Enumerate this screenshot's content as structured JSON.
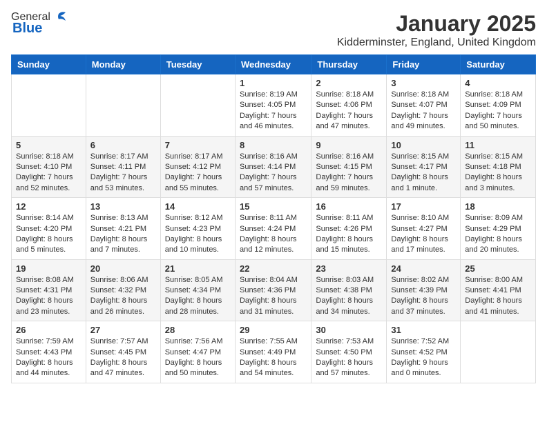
{
  "header": {
    "logo_general": "General",
    "logo_blue": "Blue",
    "month_title": "January 2025",
    "location": "Kidderminster, England, United Kingdom"
  },
  "days_of_week": [
    "Sunday",
    "Monday",
    "Tuesday",
    "Wednesday",
    "Thursday",
    "Friday",
    "Saturday"
  ],
  "weeks": [
    [
      {
        "day": "",
        "info": ""
      },
      {
        "day": "",
        "info": ""
      },
      {
        "day": "",
        "info": ""
      },
      {
        "day": "1",
        "info": "Sunrise: 8:19 AM\nSunset: 4:05 PM\nDaylight: 7 hours and 46 minutes."
      },
      {
        "day": "2",
        "info": "Sunrise: 8:18 AM\nSunset: 4:06 PM\nDaylight: 7 hours and 47 minutes."
      },
      {
        "day": "3",
        "info": "Sunrise: 8:18 AM\nSunset: 4:07 PM\nDaylight: 7 hours and 49 minutes."
      },
      {
        "day": "4",
        "info": "Sunrise: 8:18 AM\nSunset: 4:09 PM\nDaylight: 7 hours and 50 minutes."
      }
    ],
    [
      {
        "day": "5",
        "info": "Sunrise: 8:18 AM\nSunset: 4:10 PM\nDaylight: 7 hours and 52 minutes."
      },
      {
        "day": "6",
        "info": "Sunrise: 8:17 AM\nSunset: 4:11 PM\nDaylight: 7 hours and 53 minutes."
      },
      {
        "day": "7",
        "info": "Sunrise: 8:17 AM\nSunset: 4:12 PM\nDaylight: 7 hours and 55 minutes."
      },
      {
        "day": "8",
        "info": "Sunrise: 8:16 AM\nSunset: 4:14 PM\nDaylight: 7 hours and 57 minutes."
      },
      {
        "day": "9",
        "info": "Sunrise: 8:16 AM\nSunset: 4:15 PM\nDaylight: 7 hours and 59 minutes."
      },
      {
        "day": "10",
        "info": "Sunrise: 8:15 AM\nSunset: 4:17 PM\nDaylight: 8 hours and 1 minute."
      },
      {
        "day": "11",
        "info": "Sunrise: 8:15 AM\nSunset: 4:18 PM\nDaylight: 8 hours and 3 minutes."
      }
    ],
    [
      {
        "day": "12",
        "info": "Sunrise: 8:14 AM\nSunset: 4:20 PM\nDaylight: 8 hours and 5 minutes."
      },
      {
        "day": "13",
        "info": "Sunrise: 8:13 AM\nSunset: 4:21 PM\nDaylight: 8 hours and 7 minutes."
      },
      {
        "day": "14",
        "info": "Sunrise: 8:12 AM\nSunset: 4:23 PM\nDaylight: 8 hours and 10 minutes."
      },
      {
        "day": "15",
        "info": "Sunrise: 8:11 AM\nSunset: 4:24 PM\nDaylight: 8 hours and 12 minutes."
      },
      {
        "day": "16",
        "info": "Sunrise: 8:11 AM\nSunset: 4:26 PM\nDaylight: 8 hours and 15 minutes."
      },
      {
        "day": "17",
        "info": "Sunrise: 8:10 AM\nSunset: 4:27 PM\nDaylight: 8 hours and 17 minutes."
      },
      {
        "day": "18",
        "info": "Sunrise: 8:09 AM\nSunset: 4:29 PM\nDaylight: 8 hours and 20 minutes."
      }
    ],
    [
      {
        "day": "19",
        "info": "Sunrise: 8:08 AM\nSunset: 4:31 PM\nDaylight: 8 hours and 23 minutes."
      },
      {
        "day": "20",
        "info": "Sunrise: 8:06 AM\nSunset: 4:32 PM\nDaylight: 8 hours and 26 minutes."
      },
      {
        "day": "21",
        "info": "Sunrise: 8:05 AM\nSunset: 4:34 PM\nDaylight: 8 hours and 28 minutes."
      },
      {
        "day": "22",
        "info": "Sunrise: 8:04 AM\nSunset: 4:36 PM\nDaylight: 8 hours and 31 minutes."
      },
      {
        "day": "23",
        "info": "Sunrise: 8:03 AM\nSunset: 4:38 PM\nDaylight: 8 hours and 34 minutes."
      },
      {
        "day": "24",
        "info": "Sunrise: 8:02 AM\nSunset: 4:39 PM\nDaylight: 8 hours and 37 minutes."
      },
      {
        "day": "25",
        "info": "Sunrise: 8:00 AM\nSunset: 4:41 PM\nDaylight: 8 hours and 41 minutes."
      }
    ],
    [
      {
        "day": "26",
        "info": "Sunrise: 7:59 AM\nSunset: 4:43 PM\nDaylight: 8 hours and 44 minutes."
      },
      {
        "day": "27",
        "info": "Sunrise: 7:57 AM\nSunset: 4:45 PM\nDaylight: 8 hours and 47 minutes."
      },
      {
        "day": "28",
        "info": "Sunrise: 7:56 AM\nSunset: 4:47 PM\nDaylight: 8 hours and 50 minutes."
      },
      {
        "day": "29",
        "info": "Sunrise: 7:55 AM\nSunset: 4:49 PM\nDaylight: 8 hours and 54 minutes."
      },
      {
        "day": "30",
        "info": "Sunrise: 7:53 AM\nSunset: 4:50 PM\nDaylight: 8 hours and 57 minutes."
      },
      {
        "day": "31",
        "info": "Sunrise: 7:52 AM\nSunset: 4:52 PM\nDaylight: 9 hours and 0 minutes."
      },
      {
        "day": "",
        "info": ""
      }
    ]
  ]
}
